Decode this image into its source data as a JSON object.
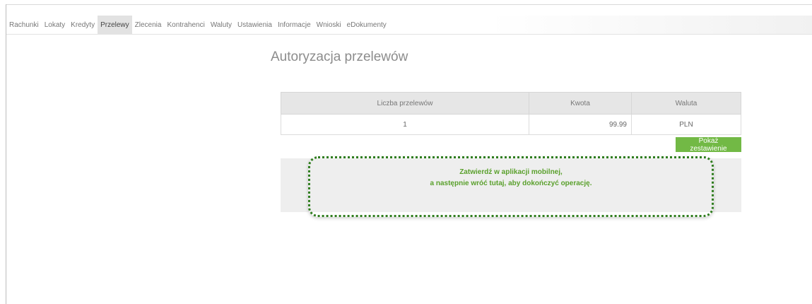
{
  "nav": {
    "items": [
      {
        "label": "Rachunki",
        "active": false
      },
      {
        "label": "Lokaty",
        "active": false
      },
      {
        "label": "Kredyty",
        "active": false
      },
      {
        "label": "Przelewy",
        "active": true
      },
      {
        "label": "Zlecenia",
        "active": false
      },
      {
        "label": "Kontrahenci",
        "active": false
      },
      {
        "label": "Waluty",
        "active": false
      },
      {
        "label": "Ustawienia",
        "active": false
      },
      {
        "label": "Informacje",
        "active": false
      },
      {
        "label": "Wnioski",
        "active": false
      },
      {
        "label": "eDokumenty",
        "active": false
      }
    ]
  },
  "main": {
    "title": "Autoryzacja przelewów",
    "table": {
      "headers": [
        "Liczba przelewów",
        "Kwota",
        "Waluta"
      ],
      "rows": [
        [
          "1",
          "99.99",
          "PLN"
        ]
      ]
    },
    "show_button_label": "Pokaż zestawienie",
    "info": {
      "line1": "Zatwierdź w aplikacji mobilnej,",
      "line2": "a następnie wróć tutaj, aby dokończyć operację."
    }
  },
  "colors": {
    "accent_green": "#72b945",
    "info_text_green": "#5aa02c",
    "highlight_frame": "#2f7d1e"
  }
}
